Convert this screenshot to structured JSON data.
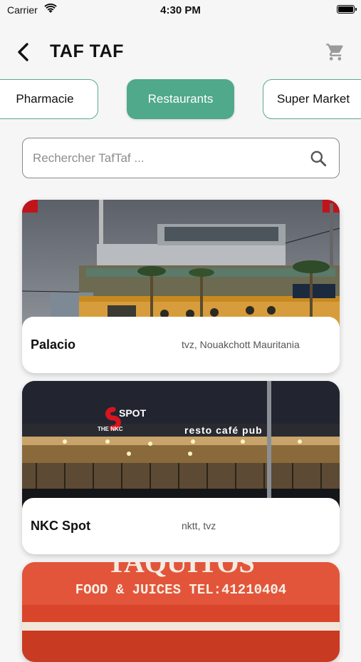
{
  "status_bar": {
    "carrier": "Carrier",
    "time": "4:30 PM"
  },
  "header": {
    "title": "TAF TAF",
    "back_icon": "chevron-left-icon",
    "cart_icon": "shopping-cart-icon"
  },
  "categories": [
    {
      "label": "Pharmacie",
      "active": false
    },
    {
      "label": "Restaurants",
      "active": true
    },
    {
      "label": "Super Market",
      "active": false
    }
  ],
  "search": {
    "placeholder": "Rechercher TafTaf ...",
    "value": "",
    "icon": "search-icon"
  },
  "colors": {
    "accent": "#4fa98a",
    "accent_border": "#5aa98a",
    "background": "#f6f6f6"
  },
  "restaurants": [
    {
      "name": "Palacio",
      "location": "tvz, Nouakchott Mauritania"
    },
    {
      "name": "NKC Spot",
      "location": "nktt, tvz",
      "sign_text": [
        "THE NKC",
        "SPOT",
        "resto café pub"
      ]
    },
    {
      "name": "",
      "location": "",
      "sign_text": [
        "TAQUITOS",
        "FOOD & JUICES TEL:41210404"
      ]
    }
  ]
}
